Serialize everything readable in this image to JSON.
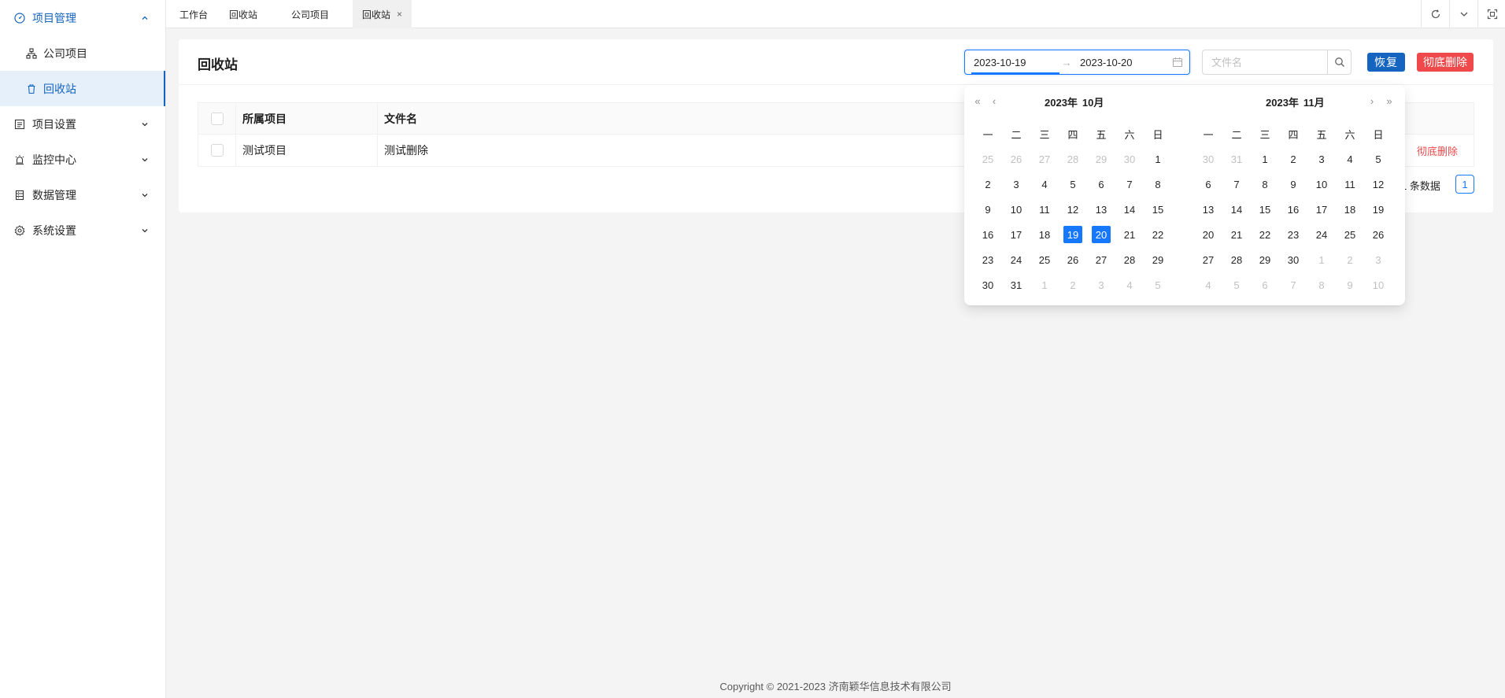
{
  "sidebar": {
    "project_mgmt": "项目管理",
    "company_projects": "公司项目",
    "recycle_bin": "回收站",
    "project_settings": "项目设置",
    "monitor_center": "监控中心",
    "data_mgmt": "数据管理",
    "system_settings": "系统设置"
  },
  "tabs": [
    "工作台",
    "回收站",
    "公司项目",
    "回收站"
  ],
  "tab_close": "×",
  "card": {
    "title": "回收站",
    "range_start": "2023-10-19",
    "range_arrow": "→",
    "range_end": "2023-10-20",
    "search_placeholder": "文件名",
    "restore_label": "恢复",
    "delete_label": "彻底删除"
  },
  "table": {
    "headers": [
      "所属项目",
      "文件名"
    ],
    "rows": [
      {
        "project": "测试项目",
        "file": "测试删除",
        "action": "彻底删除"
      }
    ]
  },
  "pager": {
    "total_text": "共1 条数据",
    "page": "1"
  },
  "datepicker": {
    "nav": {
      "prev_year": "«",
      "prev_month": "‹",
      "next_month": "›",
      "next_year": "»"
    },
    "left_year": "2023年",
    "left_month": "10月",
    "right_year": "2023年",
    "right_month": "11月",
    "weekdays": [
      "一",
      "二",
      "三",
      "四",
      "五",
      "六",
      "日"
    ],
    "left_days": [
      {
        "d": "25",
        "out": true
      },
      {
        "d": "26",
        "out": true
      },
      {
        "d": "27",
        "out": true
      },
      {
        "d": "28",
        "out": true
      },
      {
        "d": "29",
        "out": true
      },
      {
        "d": "30",
        "out": true
      },
      {
        "d": "1"
      },
      {
        "d": "2"
      },
      {
        "d": "3"
      },
      {
        "d": "4"
      },
      {
        "d": "5"
      },
      {
        "d": "6"
      },
      {
        "d": "7"
      },
      {
        "d": "8"
      },
      {
        "d": "9"
      },
      {
        "d": "10"
      },
      {
        "d": "11"
      },
      {
        "d": "12"
      },
      {
        "d": "13"
      },
      {
        "d": "14"
      },
      {
        "d": "15"
      },
      {
        "d": "16"
      },
      {
        "d": "17"
      },
      {
        "d": "18"
      },
      {
        "d": "19",
        "sel": true
      },
      {
        "d": "20",
        "sel": true
      },
      {
        "d": "21"
      },
      {
        "d": "22"
      },
      {
        "d": "23"
      },
      {
        "d": "24"
      },
      {
        "d": "25"
      },
      {
        "d": "26"
      },
      {
        "d": "27"
      },
      {
        "d": "28"
      },
      {
        "d": "29"
      },
      {
        "d": "30"
      },
      {
        "d": "31"
      },
      {
        "d": "1",
        "out": true
      },
      {
        "d": "2",
        "out": true
      },
      {
        "d": "3",
        "out": true
      },
      {
        "d": "4",
        "out": true
      },
      {
        "d": "5",
        "out": true
      }
    ],
    "right_days": [
      {
        "d": "30",
        "out": true
      },
      {
        "d": "31",
        "out": true
      },
      {
        "d": "1"
      },
      {
        "d": "2"
      },
      {
        "d": "3"
      },
      {
        "d": "4"
      },
      {
        "d": "5"
      },
      {
        "d": "6"
      },
      {
        "d": "7"
      },
      {
        "d": "8"
      },
      {
        "d": "9"
      },
      {
        "d": "10"
      },
      {
        "d": "11"
      },
      {
        "d": "12"
      },
      {
        "d": "13"
      },
      {
        "d": "14"
      },
      {
        "d": "15"
      },
      {
        "d": "16"
      },
      {
        "d": "17"
      },
      {
        "d": "18"
      },
      {
        "d": "19"
      },
      {
        "d": "20"
      },
      {
        "d": "21"
      },
      {
        "d": "22"
      },
      {
        "d": "23"
      },
      {
        "d": "24"
      },
      {
        "d": "25"
      },
      {
        "d": "26"
      },
      {
        "d": "27"
      },
      {
        "d": "28"
      },
      {
        "d": "29"
      },
      {
        "d": "30"
      },
      {
        "d": "1",
        "out": true
      },
      {
        "d": "2",
        "out": true
      },
      {
        "d": "3",
        "out": true
      },
      {
        "d": "4",
        "out": true
      },
      {
        "d": "5",
        "out": true
      },
      {
        "d": "6",
        "out": true
      },
      {
        "d": "7",
        "out": true
      },
      {
        "d": "8",
        "out": true
      },
      {
        "d": "9",
        "out": true
      },
      {
        "d": "10",
        "out": true
      }
    ]
  },
  "footer": "Copyright © 2021-2023 济南颖华信息技术有限公司",
  "colors": {
    "accent": "#1565c0",
    "primary": "#1677ff",
    "danger": "#f0494b",
    "active_bg": "#e6f0fb"
  }
}
